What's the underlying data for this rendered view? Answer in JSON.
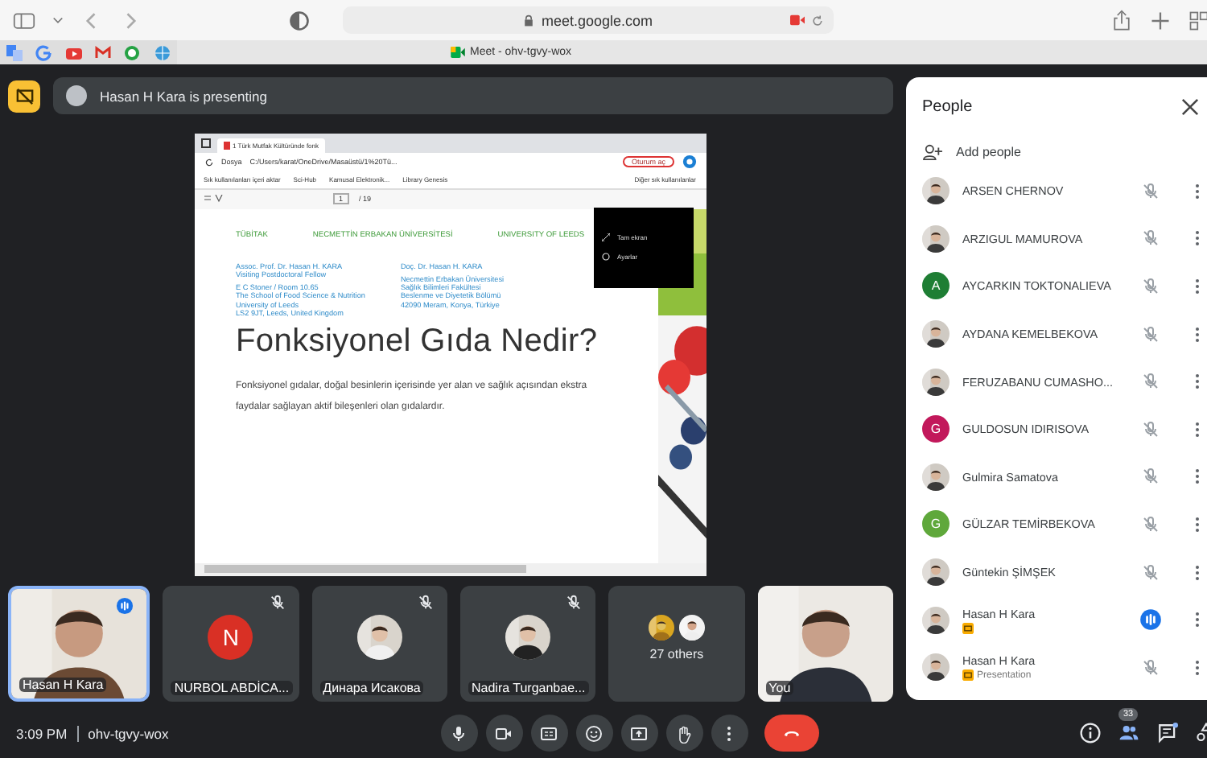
{
  "browser": {
    "url": "meet.google.com",
    "tab_title": "Meet - ohv-tgvy-wox"
  },
  "presenting_banner": "Hasan H Kara is presenting",
  "shared_screen": {
    "tab_title": "1 Türk Mutfak Kültüründe fonk",
    "file_label": "Dosya",
    "address": "C:/Users/karat/OneDrive/Masaüstü/1%20Tü...",
    "sign_in": "Oturum aç",
    "favorites": [
      "Sık kullanılanları içeri aktar",
      "Sci-Hub",
      "Kamusal Elektronik...",
      "Library Genesis"
    ],
    "other_favorites": "Diğer sık kullanılanlar",
    "page": "1",
    "page_count": "/ 19",
    "menu": [
      "Tam ekran",
      "Ayarlar"
    ],
    "slide": {
      "institutions": [
        "TÜBİTAK",
        "NECMETTİN ERBAKAN ÜNİVERSİTESİ",
        "UNIVERSITY OF LEEDS"
      ],
      "left_block": [
        "Assoc. Prof. Dr. Hasan H. KARA",
        "Visiting Postdoctoral Fellow",
        "E C Stoner / Room 10.65",
        "The School of Food Science & Nutrition",
        "University of Leeds",
        "LS2 9JT, Leeds, United Kingdom"
      ],
      "right_block": [
        "Doç. Dr. Hasan H. KARA",
        "Necmettin Erbakan Üniversitesi",
        "Sağlık Bilimleri Fakültesi",
        "Beslenme ve Diyetetik Bölümü",
        "42090 Meram, Konya, Türkiye"
      ],
      "title": "Fonksiyonel Gıda Nedir?",
      "body": "Fonksiyonel gıdalar, doğal besinlerin içerisinde yer alan ve sağlık açısından ekstra faydalar sağlayan aktif bileşenleri olan gıdalardır."
    }
  },
  "tiles": [
    {
      "kind": "video",
      "name": "Hasan H Kara",
      "speaking": true,
      "muted": false
    },
    {
      "kind": "letter",
      "initial": "N",
      "color": "#d93025",
      "name": "NURBOL ABDİCA...",
      "speaking": false,
      "muted": true
    },
    {
      "name": "Динара Исакова",
      "speaking": false,
      "muted": true
    },
    {
      "name": "Nadira Turganbae...",
      "speaking": false,
      "muted": true
    },
    {
      "kind": "others",
      "name": "27 others",
      "speaking": false,
      "muted": false
    },
    {
      "kind": "video",
      "name": "You",
      "speaking": false,
      "muted": false
    }
  ],
  "bottom_bar": {
    "time": "3:09 PM",
    "meeting_code": "ohv-tgvy-wox",
    "people_count": "33"
  },
  "people_panel": {
    "title": "People",
    "add_people": "Add people",
    "participants": [
      {
        "name": "ARSEN CHERNOV",
        "speaking": false,
        "muted": true,
        "presenting": false
      },
      {
        "name": "ARZIGUL MAMUROVA",
        "speaking": false,
        "muted": true,
        "presenting": false
      },
      {
        "name": "AYCARKIN TOKTONALIEVA",
        "kind": "letter",
        "initial": "A",
        "color": "#1e7e34",
        "speaking": false,
        "muted": true,
        "presenting": false
      },
      {
        "name": "AYDANA KEMELBEKOVA",
        "speaking": false,
        "muted": true,
        "presenting": false
      },
      {
        "name": "FERUZABANU CUMASHO...",
        "speaking": false,
        "muted": true,
        "presenting": false
      },
      {
        "name": "GULDOSUN IDIRISOVA",
        "kind": "letter",
        "initial": "G",
        "color": "#c2185b",
        "speaking": false,
        "muted": true,
        "presenting": false
      },
      {
        "name": "Gulmira Samatova",
        "speaking": false,
        "muted": true,
        "presenting": false
      },
      {
        "name": "GÜLZAR TEMİRBEKOVA",
        "kind": "letter",
        "initial": "G",
        "color": "#5fa83b",
        "speaking": false,
        "muted": true,
        "presenting": false
      },
      {
        "name": "Güntekin ŞİMŞEK",
        "speaking": false,
        "muted": true,
        "presenting": false
      },
      {
        "name": "Hasan H Kara",
        "speaking": true,
        "muted": false,
        "presenting": true
      },
      {
        "name": "Hasan H Kara",
        "subtitle": "Presentation",
        "speaking": false,
        "muted": true,
        "presenting": true
      }
    ]
  }
}
